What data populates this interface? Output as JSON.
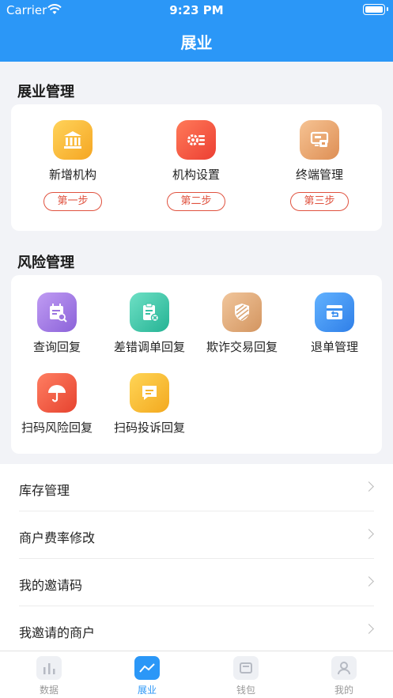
{
  "status_bar": {
    "carrier": "Carrier",
    "time": "9:23 PM"
  },
  "header": {
    "title": "展业"
  },
  "expansion": {
    "title": "展业管理",
    "items": [
      {
        "label": "新增机构",
        "step": "第一步",
        "icon": "bank-icon",
        "color": "#f6b73c"
      },
      {
        "label": "机构设置",
        "step": "第二步",
        "icon": "settings-list-icon",
        "color": "#f0553e"
      },
      {
        "label": "终端管理",
        "step": "第三步",
        "icon": "pos-terminal-icon",
        "color": "#e9a36c"
      }
    ]
  },
  "risk": {
    "title": "风险管理",
    "items": [
      {
        "label": "查询回复",
        "icon": "calendar-search-icon",
        "color": "#9f7be2"
      },
      {
        "label": "差错调单回复",
        "icon": "clipboard-error-icon",
        "color": "#3ec5ac"
      },
      {
        "label": "欺诈交易回复",
        "icon": "shield-stripes-icon",
        "color": "#dfa977"
      },
      {
        "label": "退单管理",
        "icon": "return-card-icon",
        "color": "#3a8ff0"
      },
      {
        "label": "扫码风险回复",
        "icon": "umbrella-icon",
        "color": "#ef5a44"
      },
      {
        "label": "扫码投诉回复",
        "icon": "message-icon",
        "color": "#f7be36"
      }
    ]
  },
  "list": [
    {
      "label": "库存管理"
    },
    {
      "label": "商户费率修改"
    },
    {
      "label": "我的邀请码"
    },
    {
      "label": "我邀请的商户"
    }
  ],
  "tabs": [
    {
      "label": "数据",
      "icon": "bar-chart-icon"
    },
    {
      "label": "展业",
      "icon": "trend-line-icon",
      "active": true
    },
    {
      "label": "钱包",
      "icon": "wallet-icon"
    },
    {
      "label": "我的",
      "icon": "user-icon"
    }
  ]
}
